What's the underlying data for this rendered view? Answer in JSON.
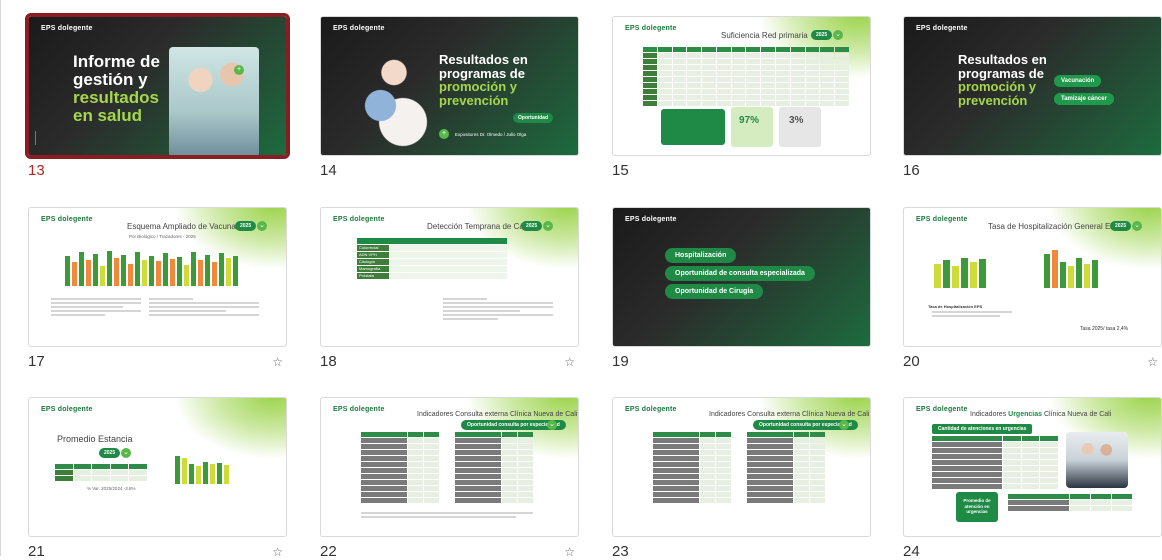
{
  "slides": [
    {
      "number": "13",
      "title_lines": [
        "Informe de",
        "gestión y"
      ],
      "accent_lines": [
        "resultados",
        "en salud"
      ],
      "logo": "EPS dolegente"
    },
    {
      "number": "14",
      "title_lines": [
        "Resultados en",
        "programas de"
      ],
      "accent_lines": [
        "promoción y",
        "prevención"
      ],
      "badge": "Oportunidad",
      "footer": "Expositores Dr. Olmedo / Julio Olga",
      "logo": "EPS dolegente"
    },
    {
      "number": "15",
      "title": "Suficiencia Red primaria",
      "badge": "2025",
      "kpi1": "97%",
      "kpi2": "3%",
      "logo": "EPS dolegente"
    },
    {
      "number": "16",
      "title_lines": [
        "Resultados en",
        "programas de"
      ],
      "accent_lines": [
        "promoción y",
        "prevención"
      ],
      "buttons": [
        "Vacunación",
        "Tamizaje cáncer"
      ],
      "logo": "EPS dolegente"
    },
    {
      "number": "17",
      "title": "Esquema Ampliado de Vacunación",
      "badge": "2025",
      "subtitle": "Por Biológico / Trazadores - 2025",
      "logo": "EPS dolegente",
      "starred": true
    },
    {
      "number": "18",
      "title": "Detección Temprana de Cáncer",
      "badge": "2025",
      "rows": [
        "Colorrectal",
        "ADN VPH",
        "Citología",
        "Mamografía",
        "Próstata"
      ],
      "logo": "EPS dolegente",
      "starred": true
    },
    {
      "number": "19",
      "buttons": [
        "Hospitalización",
        "Oportunidad de consulta especializada",
        "Oportunidad de Cirugía"
      ],
      "logo": "EPS dolegente"
    },
    {
      "number": "20",
      "title": "Tasa de Hospitalización General EPS",
      "badge": "2025",
      "subtitle": "Tasa de Hospitalización EPS",
      "note": "Tasa 2025/ tasa 2,4%",
      "logo": "EPS dolegente",
      "starred": true
    },
    {
      "number": "21",
      "title": "Promedio Estancia",
      "badge": "2025",
      "note": "% Var. 2025/2024 -3.8%",
      "logo": "EPS dolegente",
      "starred": true
    },
    {
      "number": "22",
      "title": "Indicadores Consulta externa Clínica Nueva de Cali",
      "badge": "Oportunidad consulta por especialidad",
      "logo": "EPS dolegente",
      "starred": true
    },
    {
      "number": "23",
      "title": "Indicadores Consulta externa Clínica Nueva de Cali",
      "badge": "Oportunidad consulta por especialidad",
      "logo": "EPS dolegente"
    },
    {
      "number": "24",
      "title_prefix": "Indicadores",
      "title_accent": "Urgencias",
      "title_suffix": "Clínica Nueva de Cali",
      "badge": "Cantidad de atenciones en urgencias",
      "box": "Promedio de atención en urgencias",
      "logo": "EPS dolegente"
    }
  ],
  "star_glyph": "☆",
  "colors": {
    "brand_green": "#1f8a45",
    "lime": "#8cc63f",
    "selection": "#8a1c22"
  }
}
